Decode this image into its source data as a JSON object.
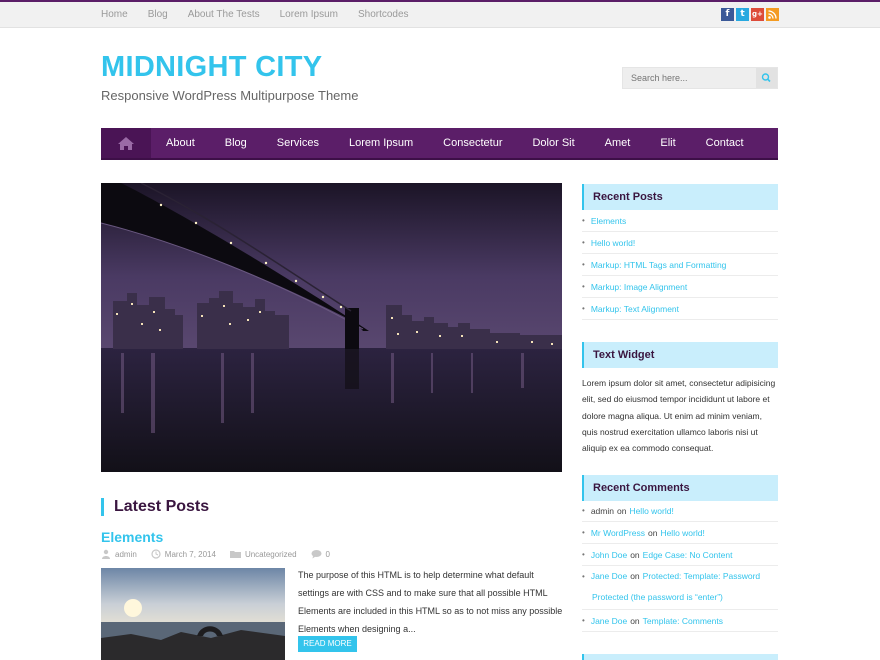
{
  "topbar": {
    "links": [
      "Home",
      "Blog",
      "About The Tests",
      "Lorem Ipsum",
      "Shortcodes"
    ],
    "social": [
      {
        "name": "facebook-icon",
        "glyph": "f",
        "color": "#3b5998"
      },
      {
        "name": "twitter-icon",
        "glyph": "t",
        "color": "#28a9e0"
      },
      {
        "name": "googleplus-icon",
        "glyph": "g+",
        "color": "#dd4b39"
      },
      {
        "name": "rss-icon",
        "glyph": "◔",
        "color": "#f49b21"
      }
    ]
  },
  "site": {
    "title": "MIDNIGHT CITY",
    "tagline": "Responsive WordPress Multipurpose Theme"
  },
  "search": {
    "placeholder": "Search here..."
  },
  "nav": {
    "items": [
      "About",
      "Blog",
      "Services",
      "Lorem Ipsum",
      "Consectetur",
      "Dolor Sit",
      "Amet",
      "Elit",
      "Contact"
    ]
  },
  "latest": {
    "heading": "Latest Posts",
    "post": {
      "title": "Elements",
      "author": "admin",
      "date": "March 7, 2014",
      "category": "Uncategorized",
      "comments": "0",
      "excerpt": "The purpose of this HTML is to help determine what default settings are with CSS and to make sure that all possible HTML Elements are included in this HTML so as to not miss any possible Elements when designing a...",
      "read_more": "READ MORE"
    }
  },
  "sidebar": {
    "recent_posts": {
      "heading": "Recent Posts",
      "items": [
        "Elements",
        "Hello world!",
        "Markup: HTML Tags and Formatting",
        "Markup: Image Alignment",
        "Markup: Text Alignment"
      ]
    },
    "text_widget": {
      "heading": "Text Widget",
      "body": "Lorem ipsum dolor sit amet, consectetur adipisicing elit, sed do eiusmod tempor incididunt ut labore et dolore magna aliqua. Ut enim ad minim veniam, quis nostrud exercitation ullamco laboris nisi ut aliquip ex ea commodo consequat."
    },
    "recent_comments": {
      "heading": "Recent Comments",
      "connector": "on",
      "items": [
        {
          "author": "admin",
          "author_link": false,
          "post": "Hello world!"
        },
        {
          "author": "Mr WordPress",
          "author_link": true,
          "post": "Hello world!"
        },
        {
          "author": "John Doe",
          "author_link": true,
          "post": "Edge Case: No Content"
        },
        {
          "author": "Jane Doe",
          "author_link": true,
          "post": "Protected: Template: Password Protected (the password is “enter”)"
        },
        {
          "author": "Jane Doe",
          "author_link": true,
          "post": "Template: Comments"
        }
      ]
    }
  },
  "colors": {
    "accent": "#33c4ec",
    "nav": "#5b1e68",
    "widget_bg": "#c9eefc"
  }
}
